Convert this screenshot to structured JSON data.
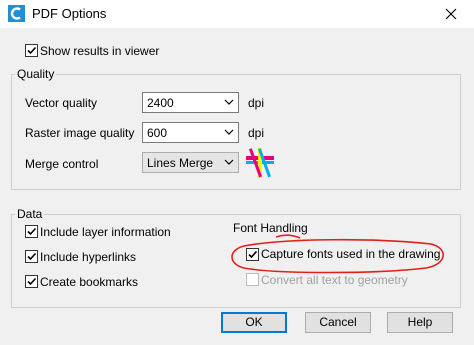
{
  "window": {
    "title": "PDF Options",
    "app_icon": "autocad-c-icon",
    "close_icon": "close-icon"
  },
  "general": {
    "show_results_label": "Show results in viewer",
    "show_results_checked": true
  },
  "quality": {
    "title": "Quality",
    "vector_label": "Vector quality",
    "vector_value": "2400",
    "vector_unit": "dpi",
    "raster_label": "Raster image quality",
    "raster_value": "600",
    "raster_unit": "dpi",
    "merge_label": "Merge control",
    "merge_value": "Lines Merge",
    "merge_icon": "lines-merge-icon"
  },
  "data": {
    "title": "Data",
    "include_layer_label": "Include layer information",
    "include_layer_checked": true,
    "include_hyperlinks_label": "Include hyperlinks",
    "include_hyperlinks_checked": true,
    "create_bookmarks_label": "Create bookmarks",
    "create_bookmarks_checked": true
  },
  "font_handling": {
    "title": "Font Handling",
    "capture_fonts_label": "Capture fonts used in the drawing",
    "capture_fonts_checked": true,
    "convert_text_label": "Convert all text to geometry",
    "convert_text_checked": false,
    "convert_text_enabled": false,
    "annotation_color": "#e0201a"
  },
  "buttons": {
    "ok": "OK",
    "cancel": "Cancel",
    "help": "Help",
    "accent": "#0078d7"
  }
}
